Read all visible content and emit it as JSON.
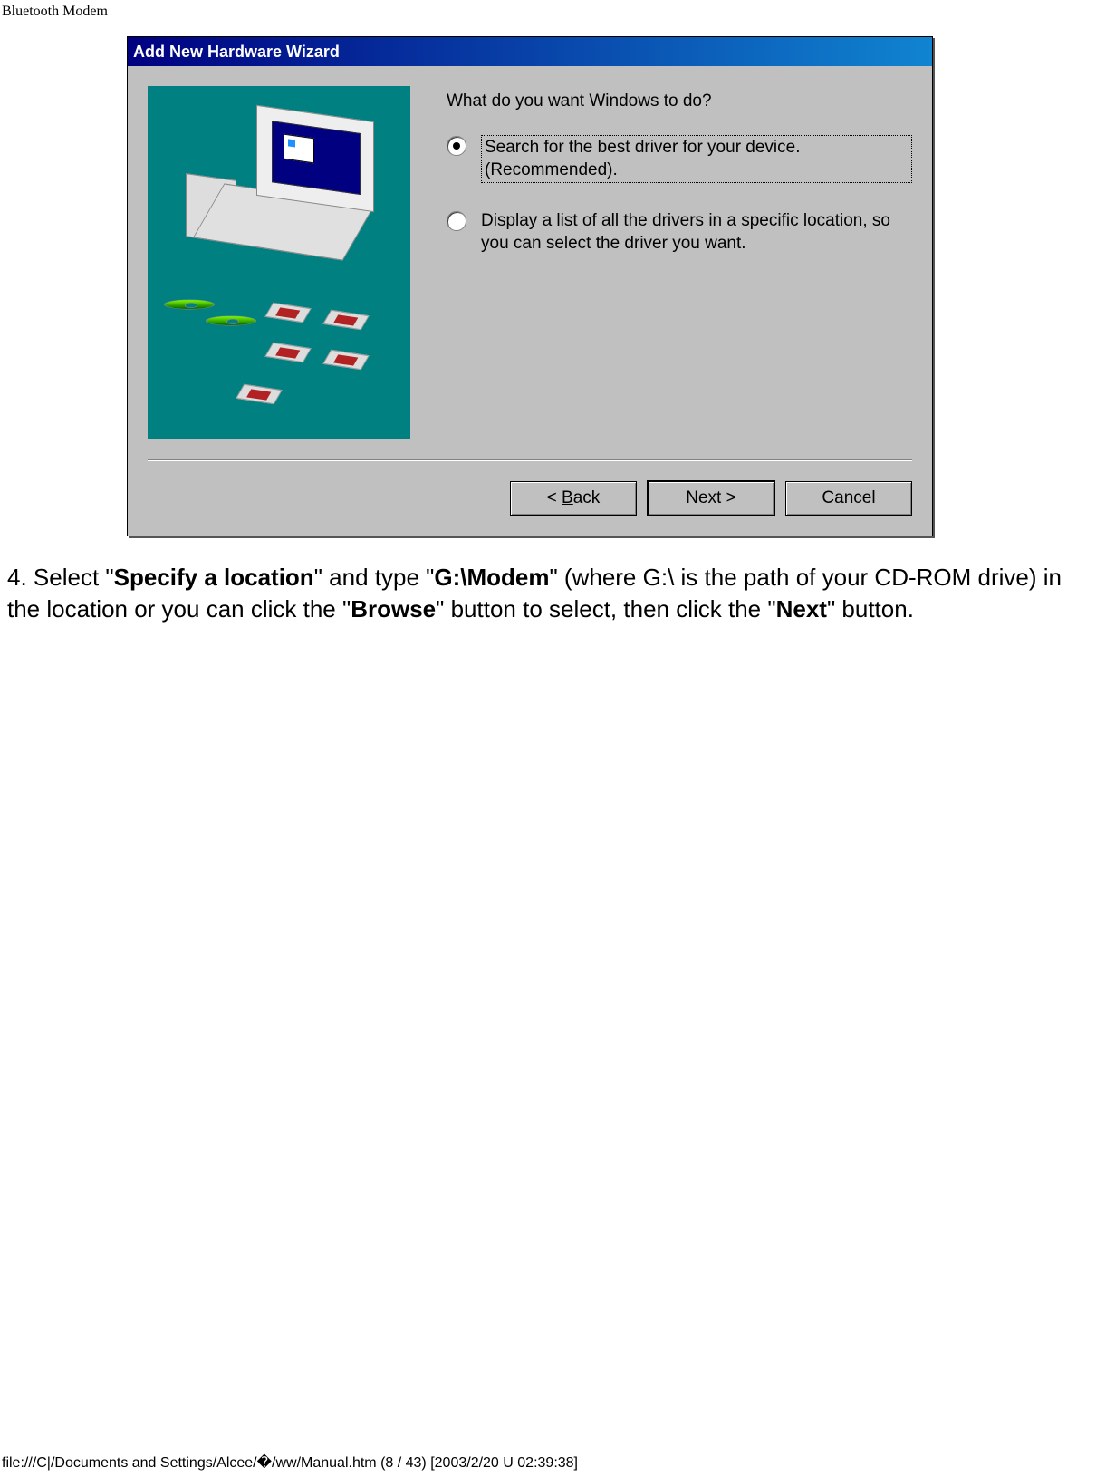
{
  "page": {
    "header": "Bluetooth Modem",
    "footer": "file:///C|/Documents and Settings/Alcee/�/ww/Manual.htm (8 / 43) [2003/2/20 U 02:39:38]"
  },
  "dialog": {
    "title": "Add New Hardware Wizard",
    "question": "What do you want Windows to do?",
    "options": {
      "opt1": "Search for the best driver for your device. (Recommended).",
      "opt2": "Display a list of all the drivers in a specific location, so you can select the driver you want."
    },
    "buttons": {
      "back_prefix": "< ",
      "back_u": "B",
      "back_suffix": "ack",
      "next": "Next >",
      "cancel": "Cancel"
    }
  },
  "instruction": {
    "t1": "4. Select \"",
    "b1": "Specify a location",
    "t2": "\" and type \"",
    "b2": "G:\\Modem",
    "t3": "\" (where G:\\ is the path of your CD-ROM drive) in the location or you can click the \"",
    "b3": "Browse",
    "t4": "\" button to select, then click the \"",
    "b4": "Next",
    "t5": "\" button."
  }
}
